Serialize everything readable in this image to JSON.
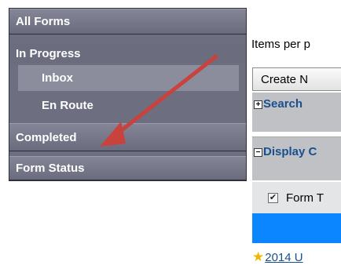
{
  "nav": {
    "all_forms": "All Forms",
    "in_progress": "In Progress",
    "inbox": "Inbox",
    "en_route": "En Route",
    "completed": "Completed",
    "form_status": "Form Status"
  },
  "main": {
    "items_per_page": "Items per p",
    "create_button": "Create N",
    "search_toggle": "+",
    "search_label": "Search",
    "display_toggle": "−",
    "display_label": "Display C",
    "form_checkbox_label": "Form T",
    "favorite_link": "2014 U"
  },
  "colors": {
    "nav_background": "#6d6e80",
    "selected_item": "#8b8c9c",
    "section_header": "#bfc1c4",
    "link": "#1a4f8f",
    "highlight_bar": "#0b86ff",
    "annotation_arrow": "#c8423e"
  },
  "icons": {
    "expand": "plus-box-icon",
    "collapse": "minus-box-icon",
    "favorite": "star-icon",
    "annotation": "arrow-icon"
  }
}
